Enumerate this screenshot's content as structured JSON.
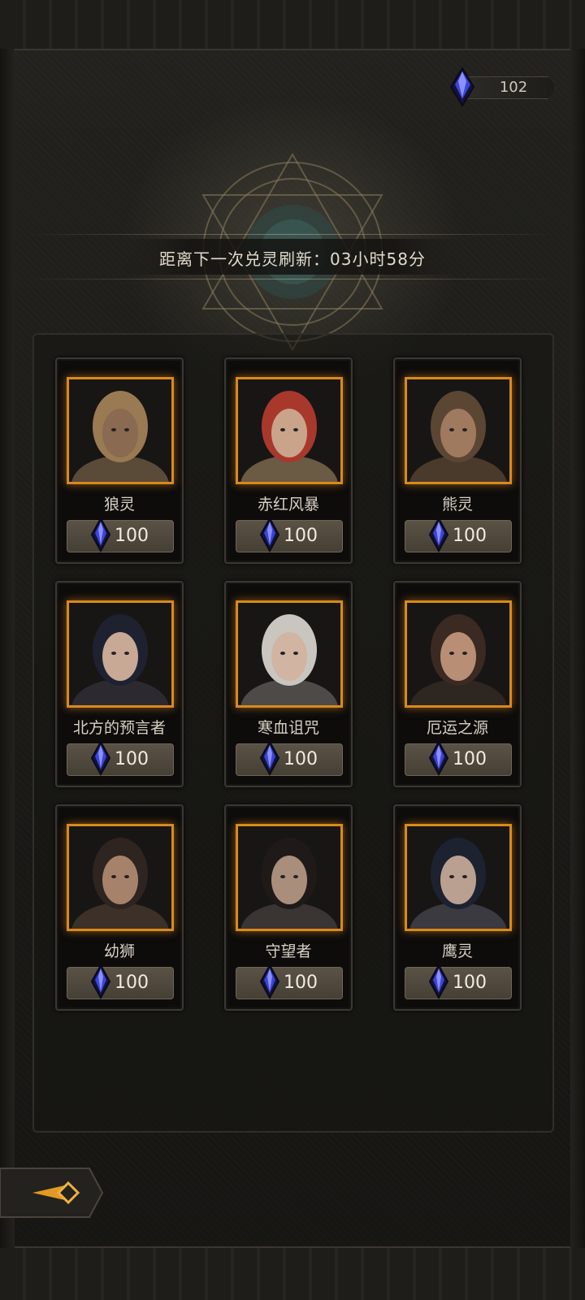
{
  "currency": {
    "amount": "102",
    "icon": "crystal-icon"
  },
  "refresh": {
    "text": "距离下一次兑灵刷新：03小时58分"
  },
  "cards": [
    {
      "name": "狼灵",
      "price": "100",
      "hair": "#9a7a52",
      "skin": "#8a6a50",
      "cloak": "#5a4a38"
    },
    {
      "name": "赤红风暴",
      "price": "100",
      "hair": "#a8382c",
      "skin": "#c9a48a",
      "cloak": "#6b5a44"
    },
    {
      "name": "熊灵",
      "price": "100",
      "hair": "#5b4634",
      "skin": "#a07a5e",
      "cloak": "#4a3a2c"
    },
    {
      "name": "北方的预言者",
      "price": "100",
      "hair": "#1e2230",
      "skin": "#c7a996",
      "cloak": "#2c2a30"
    },
    {
      "name": "寒血诅咒",
      "price": "100",
      "hair": "#c9c6c0",
      "skin": "#d2b4a2",
      "cloak": "#4e4a48"
    },
    {
      "name": "厄运之源",
      "price": "100",
      "hair": "#3a2a22",
      "skin": "#b88e74",
      "cloak": "#2e2620"
    },
    {
      "name": "幼狮",
      "price": "100",
      "hair": "#2e2420",
      "skin": "#a7826a",
      "cloak": "#3c3028"
    },
    {
      "name": "守望者",
      "price": "100",
      "hair": "#1f1a18",
      "skin": "#a98e7c",
      "cloak": "#3a3432"
    },
    {
      "name": "鹰灵",
      "price": "100",
      "hair": "#1c2230",
      "skin": "#b9a090",
      "cloak": "#3a3a40"
    }
  ],
  "back_button": {
    "icon": "back-arrow-icon"
  },
  "colors": {
    "accent": "#d88a1c",
    "gem": "#3d44d6"
  }
}
